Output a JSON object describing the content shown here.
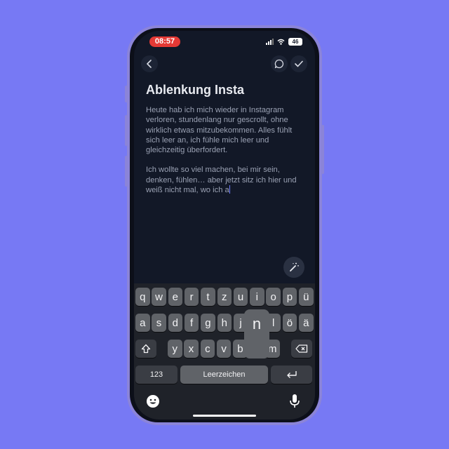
{
  "status": {
    "time": "08:57",
    "battery": "46"
  },
  "note": {
    "title": "Ablenkung Insta",
    "paragraph1": "Heute hab ich mich wieder in Instagram verloren, stundenlang nur gescrollt, ohne wirklich etwas mitzubekommen. Alles fühlt sich leer an, ich fühle mich leer und gleichzeitig überfordert.",
    "paragraph2": "Ich wollte so viel machen, bei mir sein, denken, fühlen… aber jetzt sitz ich hier und weiß nicht mal, wo ich a"
  },
  "keyboard": {
    "row1": [
      "q",
      "w",
      "e",
      "r",
      "t",
      "z",
      "u",
      "i",
      "o",
      "p",
      "ü"
    ],
    "row2": [
      "a",
      "s",
      "d",
      "f",
      "g",
      "h",
      "j",
      "n",
      "l",
      "ö",
      "ä"
    ],
    "row3": [
      "y",
      "x",
      "c",
      "v",
      "b",
      "m"
    ],
    "pressed_key": "n",
    "numbers_label": "123",
    "space_label": "Leerzeichen"
  },
  "icons": [
    "back-icon",
    "comment-icon",
    "check-icon",
    "magic-wand-icon",
    "shift-icon",
    "backspace-icon",
    "return-icon",
    "emoji-icon",
    "microphone-icon"
  ],
  "colors": {
    "background": "#7779f4",
    "screen": "#121827",
    "recording": "#e53935",
    "cursor": "#6d7bff"
  }
}
